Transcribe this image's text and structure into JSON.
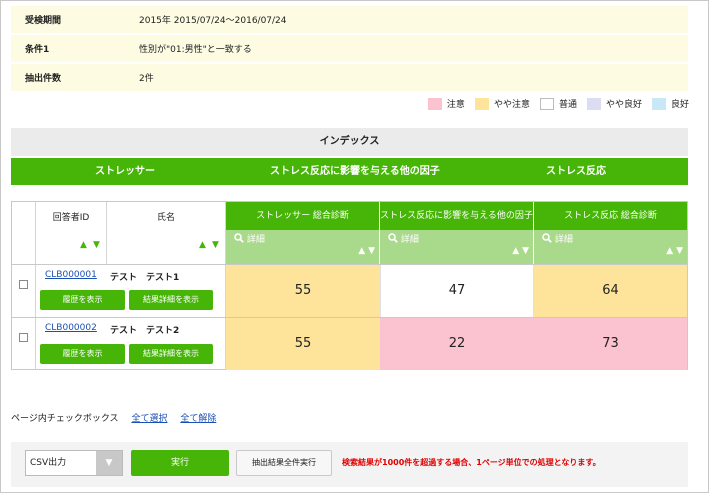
{
  "info": {
    "rows": [
      {
        "label": "受検期間",
        "value": "2015年 2015/07/24～2016/07/24"
      },
      {
        "label": "条件1",
        "value": "性別が\"01:男性\"と一致する"
      },
      {
        "label": "抽出件数",
        "value": "2件"
      }
    ]
  },
  "legend": [
    {
      "label": "注意",
      "color": "#fbc2cf"
    },
    {
      "label": "やや注意",
      "color": "#fde49a"
    },
    {
      "label": "普通",
      "color": "#ffffff"
    },
    {
      "label": "やや良好",
      "color": "#dcdcf3"
    },
    {
      "label": "良好",
      "color": "#c8e8f8"
    }
  ],
  "index_label": "インデックス",
  "green_tabs": [
    "ストレッサー",
    "ストレス反応に影響を与える他の因子",
    "ストレス反応"
  ],
  "table": {
    "col_respondent": "回答者ID",
    "col_name": "氏名",
    "score_cols": [
      "ストレッサー 総合診断",
      "ストレス反応に影響を与える他の因子",
      "ストレス反応 総合診断"
    ],
    "detail_label": "詳細",
    "sort_up": "▲",
    "sort_down": "▼",
    "history_btn": "履歴を表示",
    "result_btn": "結果詳細を表示",
    "rows": [
      {
        "id": "CLB000001",
        "name": "テスト　テスト1",
        "scores": [
          "55",
          "47",
          "64"
        ],
        "colors": [
          "#fde49a",
          "#ffffff",
          "#fde49a"
        ]
      },
      {
        "id": "CLB000002",
        "name": "テスト　テスト2",
        "scores": [
          "55",
          "22",
          "73"
        ],
        "colors": [
          "#fde49a",
          "#fbc2cf",
          "#fbc2cf"
        ]
      }
    ]
  },
  "footer": {
    "page_checkbox_label": "ページ内チェックボックス",
    "select_all": "全て選択",
    "deselect_all": "全て解除"
  },
  "actions": {
    "csv_value": "CSV出力",
    "run": "実行",
    "run_all": "抽出結果全件実行",
    "warning": "検索結果が1000件を超過する場合、1ページ単位での処理となります。"
  },
  "colors": {
    "accent": "#47b508",
    "accent_light": "#a9d98a",
    "info_bg": "#fdfce2",
    "warning": "#e10000"
  }
}
